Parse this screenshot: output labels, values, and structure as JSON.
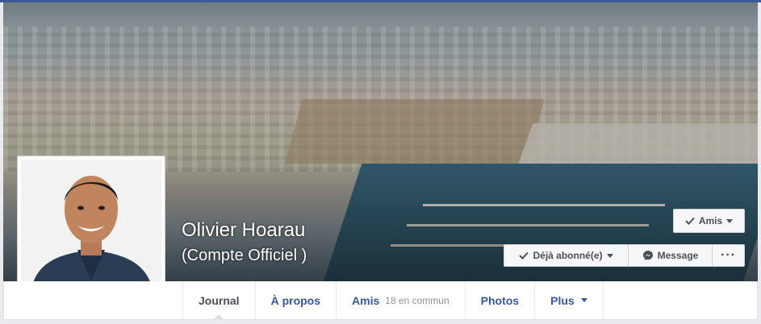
{
  "profile": {
    "name": "Olivier Hoarau",
    "subtitle": "(Compte Officiel )"
  },
  "actions": {
    "friends_label": "Amis",
    "following_label": "Déjà abonné(e)",
    "message_label": "Message",
    "more_label": "···"
  },
  "tabs": [
    {
      "label": "Journal",
      "active": true
    },
    {
      "label": "À propos"
    },
    {
      "label": "Amis",
      "count": "18 en commun"
    },
    {
      "label": "Photos"
    },
    {
      "label": "Plus",
      "has_dropdown": true
    }
  ],
  "colors": {
    "brand_blue": "#3b5998",
    "link_blue": "#365899",
    "button_bg": "#f6f7f9"
  },
  "icons": {
    "check": "check-icon",
    "messenger": "messenger-icon",
    "caret": "chevron-down-icon"
  }
}
